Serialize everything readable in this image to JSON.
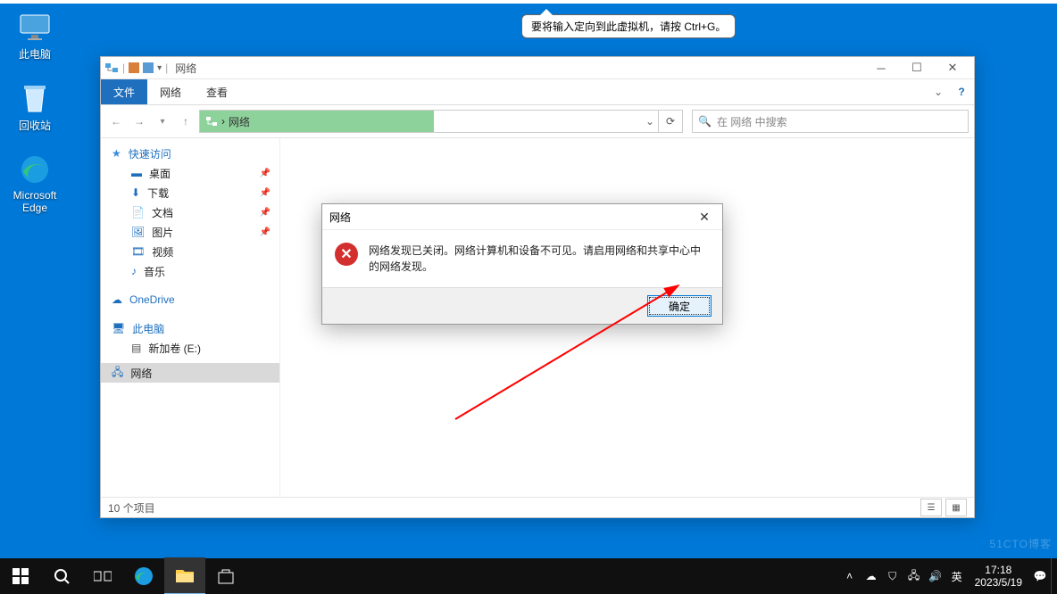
{
  "vm_tooltip": "要将输入定向到此虚拟机，请按 Ctrl+G。",
  "desktop": {
    "this_pc": "此电脑",
    "recycle": "回收站",
    "edge": "Microsoft Edge"
  },
  "explorer": {
    "title": "网络",
    "tabs": {
      "file": "文件",
      "network": "网络",
      "view": "查看"
    },
    "breadcrumb": "网络",
    "search_placeholder": "在 网络 中搜索",
    "nav": {
      "quick": "快速访问",
      "desktop": "桌面",
      "downloads": "下载",
      "documents": "文档",
      "pictures": "图片",
      "videos": "视频",
      "music": "音乐",
      "onedrive": "OneDrive",
      "this_pc": "此电脑",
      "volume_e": "新加卷 (E:)",
      "network": "网络"
    },
    "status": "10 个项目"
  },
  "dialog": {
    "title": "网络",
    "message": "网络发现已关闭。网络计算机和设备不可见。请启用网络和共享中心中的网络发现。",
    "ok": "确定"
  },
  "taskbar": {
    "ime": "英",
    "time": "17:18",
    "date": "2023/5/19"
  },
  "watermark": "51CTO博客"
}
